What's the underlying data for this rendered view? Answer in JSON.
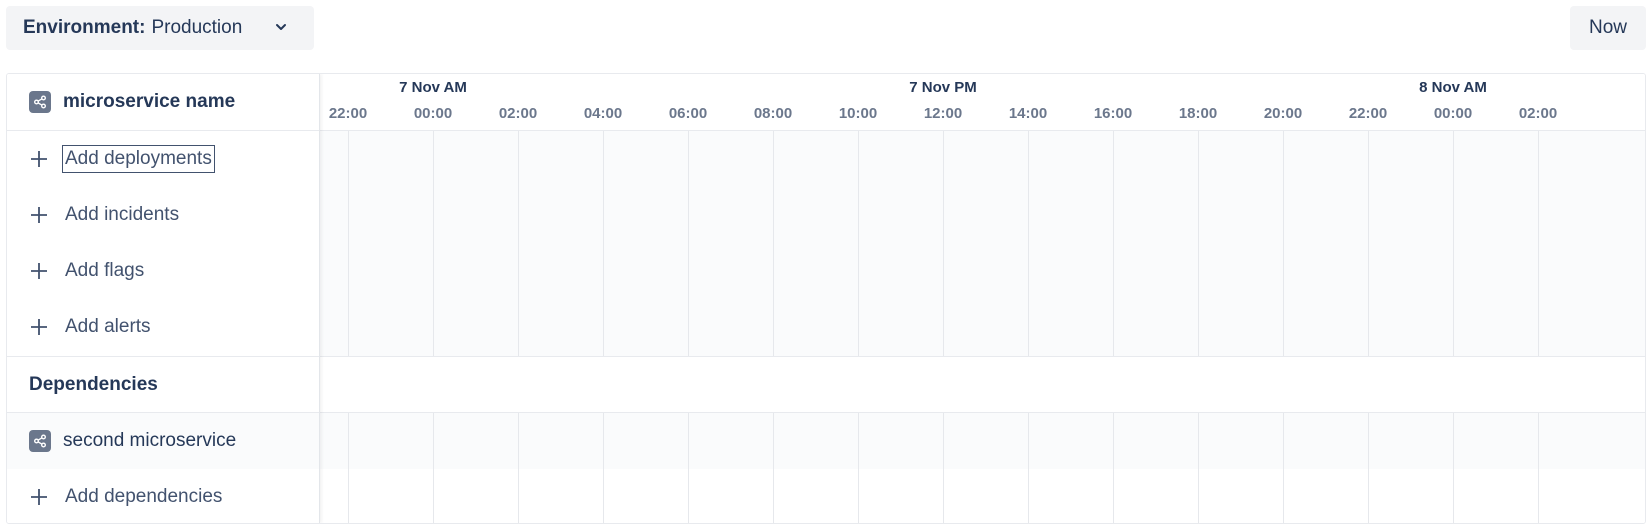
{
  "toolbar": {
    "environment_label": "Environment:",
    "environment_value": "Production",
    "now_label": "Now"
  },
  "sidebar": {
    "service_name": "microservice name",
    "add_items": [
      {
        "label": "Add deployments"
      },
      {
        "label": "Add incidents"
      },
      {
        "label": "Add flags"
      },
      {
        "label": "Add alerts"
      }
    ],
    "dependencies_heading": "Dependencies",
    "dependency_service": "second microservice",
    "add_dependencies_label": "Add dependencies"
  },
  "timeline": {
    "day_labels": [
      {
        "label": "7 Nov AM",
        "at_hour_index": 1
      },
      {
        "label": "7 Nov PM",
        "at_hour_index": 7
      },
      {
        "label": "8 Nov AM",
        "at_hour_index": 13
      }
    ],
    "hours": [
      "22:00",
      "00:00",
      "02:00",
      "04:00",
      "06:00",
      "08:00",
      "10:00",
      "12:00",
      "14:00",
      "16:00",
      "18:00",
      "20:00",
      "22:00",
      "00:00",
      "02:00"
    ]
  },
  "colors": {
    "text_primary": "#253858",
    "text_secondary": "#6b778c",
    "button_bg": "#f3f4f6",
    "grid_line": "#e6e8ec",
    "icon_bg": "#6b778c"
  },
  "icons": {
    "environment_dropdown": "chevron-down-icon",
    "service": "share-nodes-icon",
    "add": "plus-icon"
  }
}
